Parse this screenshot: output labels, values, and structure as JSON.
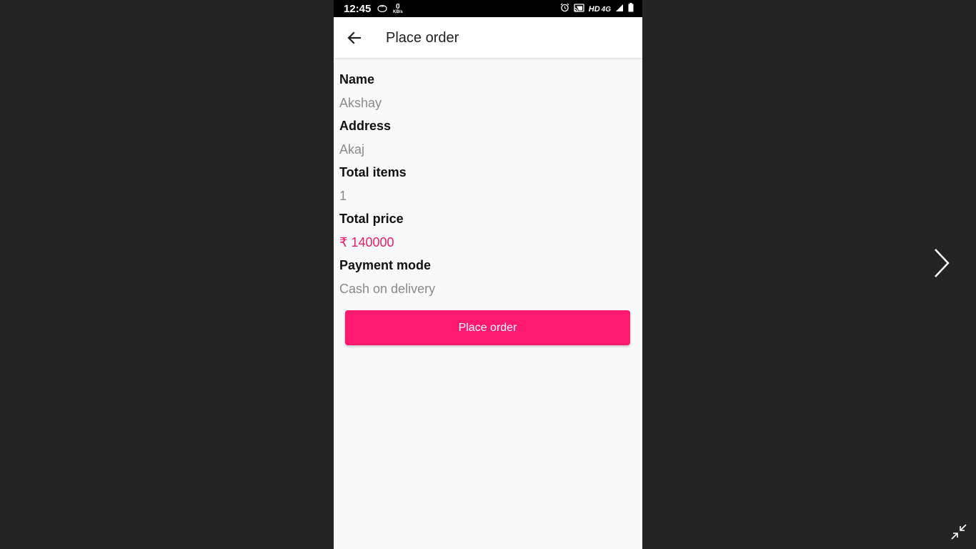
{
  "statusbar": {
    "time": "12:45",
    "data_speed_value": "0",
    "data_speed_unit": "KB/s",
    "network_hd": "HD",
    "network_type": "4G",
    "icons": [
      "ok-app-icon",
      "alarm-icon",
      "cast-icon",
      "signal-icon",
      "battery-icon"
    ]
  },
  "appbar": {
    "back_icon": "arrow-back-icon",
    "title": "Place order"
  },
  "order": {
    "name_label": "Name",
    "name_value": "Akshay",
    "address_label": "Address",
    "address_value": "Akaj",
    "items_label": "Total items",
    "items_value": "1",
    "price_label": "Total price",
    "price_value": "₹ 140000",
    "payment_label": "Payment mode",
    "payment_value": "Cash on delivery"
  },
  "actions": {
    "place_order_label": "Place order"
  },
  "viewer": {
    "next_icon": "chevron-right-icon",
    "exit_icon": "exit-fullscreen-icon"
  },
  "colors": {
    "accent": "#ff1a70",
    "price": "#e91e63",
    "background": "#232323"
  }
}
